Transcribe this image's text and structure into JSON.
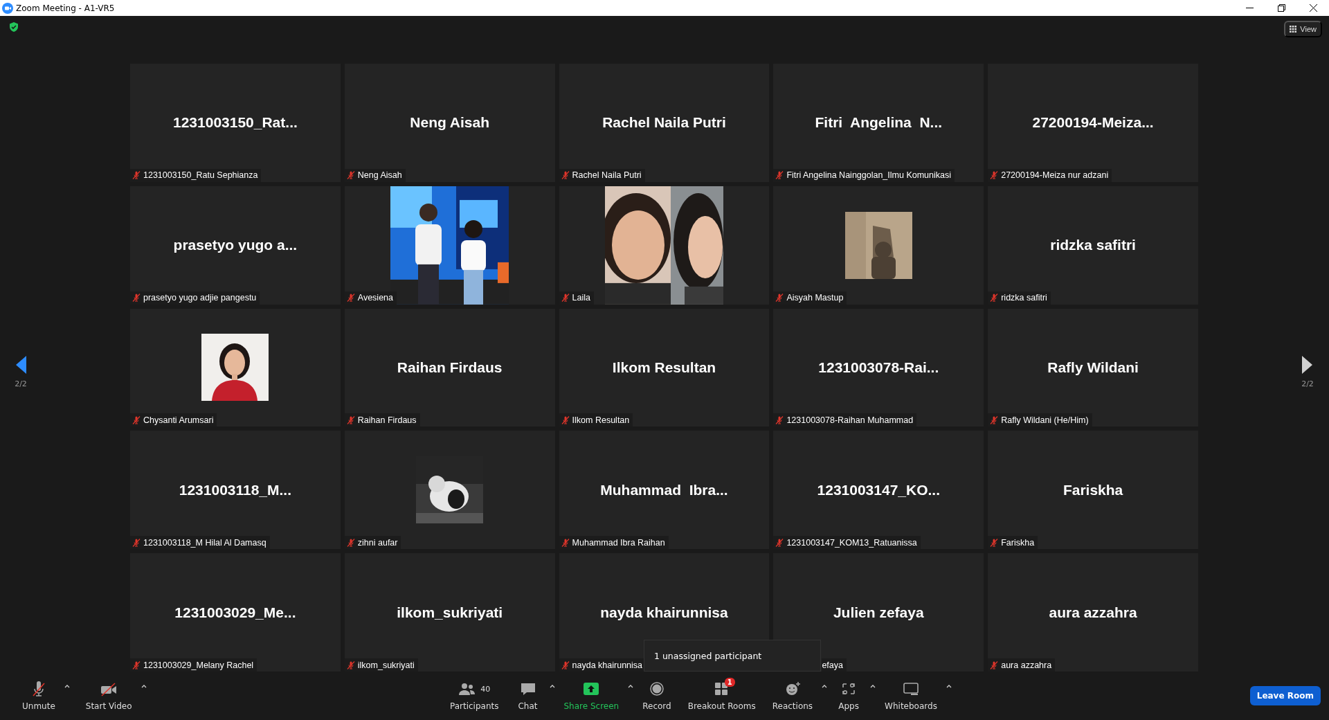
{
  "window": {
    "title": "Zoom Meeting - A1-VR5"
  },
  "top_bar": {
    "view_button": "View"
  },
  "pager": {
    "previous": {
      "label": "2/2",
      "highlighted": true
    },
    "next": {
      "label": "2/2",
      "highlighted": false
    }
  },
  "tiles": [
    {
      "kind": "name",
      "display": "1231003150_Rat...",
      "name": "1231003150_Ratu Sephianza",
      "muted": true
    },
    {
      "kind": "name",
      "display": "Neng Aisah",
      "name": "Neng Aisah",
      "muted": true
    },
    {
      "kind": "name",
      "display": "Rachel Naila Putri",
      "name": "Rachel Naila Putri",
      "muted": true
    },
    {
      "kind": "name",
      "display": "Fitri  Angelina  N...",
      "name": "Fitri Angelina Nainggolan_Ilmu Komunikasi",
      "muted": true
    },
    {
      "kind": "name",
      "display": "27200194-Meiza...",
      "name": "27200194-Meiza nur adzani",
      "muted": true
    },
    {
      "kind": "name",
      "display": "prasetyo yugo a...",
      "name": "prasetyo yugo adjie pangestu",
      "muted": true
    },
    {
      "kind": "video",
      "name": "Avesiena",
      "muted": true
    },
    {
      "kind": "video",
      "name": "Laila",
      "muted": true
    },
    {
      "name": "Aisyah Mastup",
      "muted": true
    },
    {
      "kind": "name",
      "display": "ridzka safitri",
      "name": "ridzka safitri",
      "muted": true
    },
    {
      "name": "Chysanti Arumsari",
      "muted": true
    },
    {
      "kind": "name",
      "display": "Raihan Firdaus",
      "name": "Raihan Firdaus",
      "muted": true
    },
    {
      "kind": "name",
      "display": "Ilkom Resultan",
      "name": "Ilkom Resultan",
      "muted": true
    },
    {
      "kind": "name",
      "display": "1231003078-Rai...",
      "name": "1231003078-Raihan Muhammad",
      "muted": true
    },
    {
      "kind": "name",
      "display": "Rafly Wildani",
      "name": "Rafly Wildani (He/Him)",
      "muted": true
    },
    {
      "kind": "name",
      "display": "1231003118_M...",
      "name": "1231003118_M Hilal Al Damasq",
      "muted": true
    },
    {
      "name": "zihni aufar",
      "muted": true
    },
    {
      "kind": "name",
      "display": "Muhammad  Ibra...",
      "name": "Muhammad Ibra Raihan",
      "muted": true
    },
    {
      "kind": "name",
      "display": "1231003147_KO...",
      "name": "1231003147_KOM13_Ratuanissa",
      "muted": true
    },
    {
      "kind": "name",
      "display": "Fariskha",
      "name": "Fariskha",
      "muted": true
    },
    {
      "kind": "name",
      "display": "1231003029_Me...",
      "name": "1231003029_Melany Rachel",
      "muted": true
    },
    {
      "kind": "name",
      "display": "ilkom_sukriyati",
      "name": "ilkom_sukriyati",
      "muted": true
    },
    {
      "kind": "name",
      "display": "nayda khairunnisa",
      "name": "nayda khairunnisa",
      "muted": true
    },
    {
      "kind": "name",
      "display": "Julien zefaya",
      "name": "efaya",
      "covered": true
    },
    {
      "kind": "name",
      "display": "aura azzahra",
      "name": "aura azzahra",
      "muted": true
    }
  ],
  "popup": {
    "text": "1 unassigned participant"
  },
  "toolbar": {
    "left": [
      {
        "kind": "mic",
        "label": "Unmute",
        "caret": true,
        "accent": false
      },
      {
        "kind": "video",
        "label": "Start Video",
        "caret": true,
        "accent": false
      }
    ],
    "center": [
      {
        "kind": "participants",
        "label": "Participants",
        "count": "40",
        "caret": false,
        "accent": false
      },
      {
        "kind": "chat",
        "label": "Chat",
        "caret": true,
        "accent": false
      },
      {
        "kind": "share",
        "label": "Share Screen",
        "caret": true,
        "accent": true
      },
      {
        "kind": "record",
        "label": "Record",
        "caret": false,
        "accent": false
      },
      {
        "kind": "breakout",
        "label": "Breakout Rooms",
        "badge": "1",
        "caret": false,
        "accent": false
      },
      {
        "kind": "reactions",
        "label": "Reactions",
        "caret": true,
        "accent": false
      },
      {
        "kind": "apps",
        "label": "Apps",
        "caret": true,
        "accent": false
      },
      {
        "kind": "whiteboard",
        "label": "Whiteboards",
        "caret": true,
        "accent": false
      }
    ],
    "leave_button": "Leave Room"
  }
}
